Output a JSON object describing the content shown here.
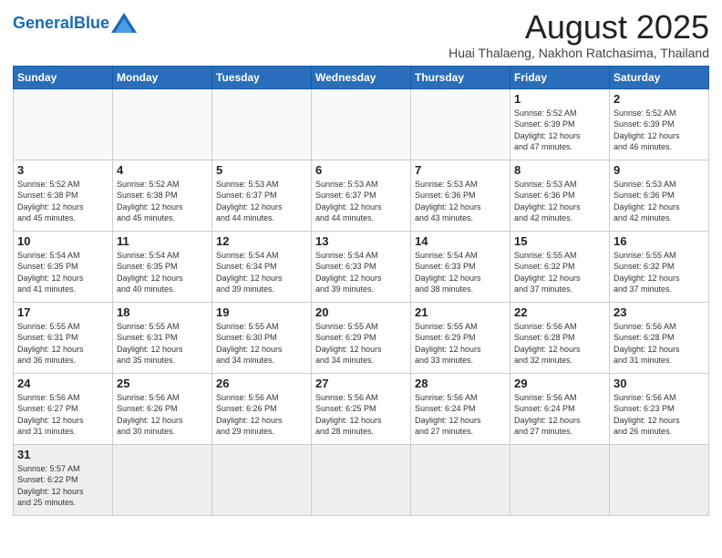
{
  "header": {
    "logo_text_normal": "General",
    "logo_text_bold": "Blue",
    "month_title": "August 2025",
    "location": "Huai Thalaeng, Nakhon Ratchasima, Thailand"
  },
  "weekdays": [
    "Sunday",
    "Monday",
    "Tuesday",
    "Wednesday",
    "Thursday",
    "Friday",
    "Saturday"
  ],
  "weeks": [
    [
      {
        "day": "",
        "info": ""
      },
      {
        "day": "",
        "info": ""
      },
      {
        "day": "",
        "info": ""
      },
      {
        "day": "",
        "info": ""
      },
      {
        "day": "",
        "info": ""
      },
      {
        "day": "1",
        "info": "Sunrise: 5:52 AM\nSunset: 6:39 PM\nDaylight: 12 hours\nand 47 minutes."
      },
      {
        "day": "2",
        "info": "Sunrise: 5:52 AM\nSunset: 6:39 PM\nDaylight: 12 hours\nand 46 minutes."
      }
    ],
    [
      {
        "day": "3",
        "info": "Sunrise: 5:52 AM\nSunset: 6:38 PM\nDaylight: 12 hours\nand 45 minutes."
      },
      {
        "day": "4",
        "info": "Sunrise: 5:52 AM\nSunset: 6:38 PM\nDaylight: 12 hours\nand 45 minutes."
      },
      {
        "day": "5",
        "info": "Sunrise: 5:53 AM\nSunset: 6:37 PM\nDaylight: 12 hours\nand 44 minutes."
      },
      {
        "day": "6",
        "info": "Sunrise: 5:53 AM\nSunset: 6:37 PM\nDaylight: 12 hours\nand 44 minutes."
      },
      {
        "day": "7",
        "info": "Sunrise: 5:53 AM\nSunset: 6:36 PM\nDaylight: 12 hours\nand 43 minutes."
      },
      {
        "day": "8",
        "info": "Sunrise: 5:53 AM\nSunset: 6:36 PM\nDaylight: 12 hours\nand 42 minutes."
      },
      {
        "day": "9",
        "info": "Sunrise: 5:53 AM\nSunset: 6:36 PM\nDaylight: 12 hours\nand 42 minutes."
      }
    ],
    [
      {
        "day": "10",
        "info": "Sunrise: 5:54 AM\nSunset: 6:35 PM\nDaylight: 12 hours\nand 41 minutes."
      },
      {
        "day": "11",
        "info": "Sunrise: 5:54 AM\nSunset: 6:35 PM\nDaylight: 12 hours\nand 40 minutes."
      },
      {
        "day": "12",
        "info": "Sunrise: 5:54 AM\nSunset: 6:34 PM\nDaylight: 12 hours\nand 39 minutes."
      },
      {
        "day": "13",
        "info": "Sunrise: 5:54 AM\nSunset: 6:33 PM\nDaylight: 12 hours\nand 39 minutes."
      },
      {
        "day": "14",
        "info": "Sunrise: 5:54 AM\nSunset: 6:33 PM\nDaylight: 12 hours\nand 38 minutes."
      },
      {
        "day": "15",
        "info": "Sunrise: 5:55 AM\nSunset: 6:32 PM\nDaylight: 12 hours\nand 37 minutes."
      },
      {
        "day": "16",
        "info": "Sunrise: 5:55 AM\nSunset: 6:32 PM\nDaylight: 12 hours\nand 37 minutes."
      }
    ],
    [
      {
        "day": "17",
        "info": "Sunrise: 5:55 AM\nSunset: 6:31 PM\nDaylight: 12 hours\nand 36 minutes."
      },
      {
        "day": "18",
        "info": "Sunrise: 5:55 AM\nSunset: 6:31 PM\nDaylight: 12 hours\nand 35 minutes."
      },
      {
        "day": "19",
        "info": "Sunrise: 5:55 AM\nSunset: 6:30 PM\nDaylight: 12 hours\nand 34 minutes."
      },
      {
        "day": "20",
        "info": "Sunrise: 5:55 AM\nSunset: 6:29 PM\nDaylight: 12 hours\nand 34 minutes."
      },
      {
        "day": "21",
        "info": "Sunrise: 5:55 AM\nSunset: 6:29 PM\nDaylight: 12 hours\nand 33 minutes."
      },
      {
        "day": "22",
        "info": "Sunrise: 5:56 AM\nSunset: 6:28 PM\nDaylight: 12 hours\nand 32 minutes."
      },
      {
        "day": "23",
        "info": "Sunrise: 5:56 AM\nSunset: 6:28 PM\nDaylight: 12 hours\nand 31 minutes."
      }
    ],
    [
      {
        "day": "24",
        "info": "Sunrise: 5:56 AM\nSunset: 6:27 PM\nDaylight: 12 hours\nand 31 minutes."
      },
      {
        "day": "25",
        "info": "Sunrise: 5:56 AM\nSunset: 6:26 PM\nDaylight: 12 hours\nand 30 minutes."
      },
      {
        "day": "26",
        "info": "Sunrise: 5:56 AM\nSunset: 6:26 PM\nDaylight: 12 hours\nand 29 minutes."
      },
      {
        "day": "27",
        "info": "Sunrise: 5:56 AM\nSunset: 6:25 PM\nDaylight: 12 hours\nand 28 minutes."
      },
      {
        "day": "28",
        "info": "Sunrise: 5:56 AM\nSunset: 6:24 PM\nDaylight: 12 hours\nand 27 minutes."
      },
      {
        "day": "29",
        "info": "Sunrise: 5:56 AM\nSunset: 6:24 PM\nDaylight: 12 hours\nand 27 minutes."
      },
      {
        "day": "30",
        "info": "Sunrise: 5:56 AM\nSunset: 6:23 PM\nDaylight: 12 hours\nand 26 minutes."
      }
    ],
    [
      {
        "day": "31",
        "info": "Sunrise: 5:57 AM\nSunset: 6:22 PM\nDaylight: 12 hours\nand 25 minutes."
      },
      {
        "day": "",
        "info": ""
      },
      {
        "day": "",
        "info": ""
      },
      {
        "day": "",
        "info": ""
      },
      {
        "day": "",
        "info": ""
      },
      {
        "day": "",
        "info": ""
      },
      {
        "day": "",
        "info": ""
      }
    ]
  ]
}
